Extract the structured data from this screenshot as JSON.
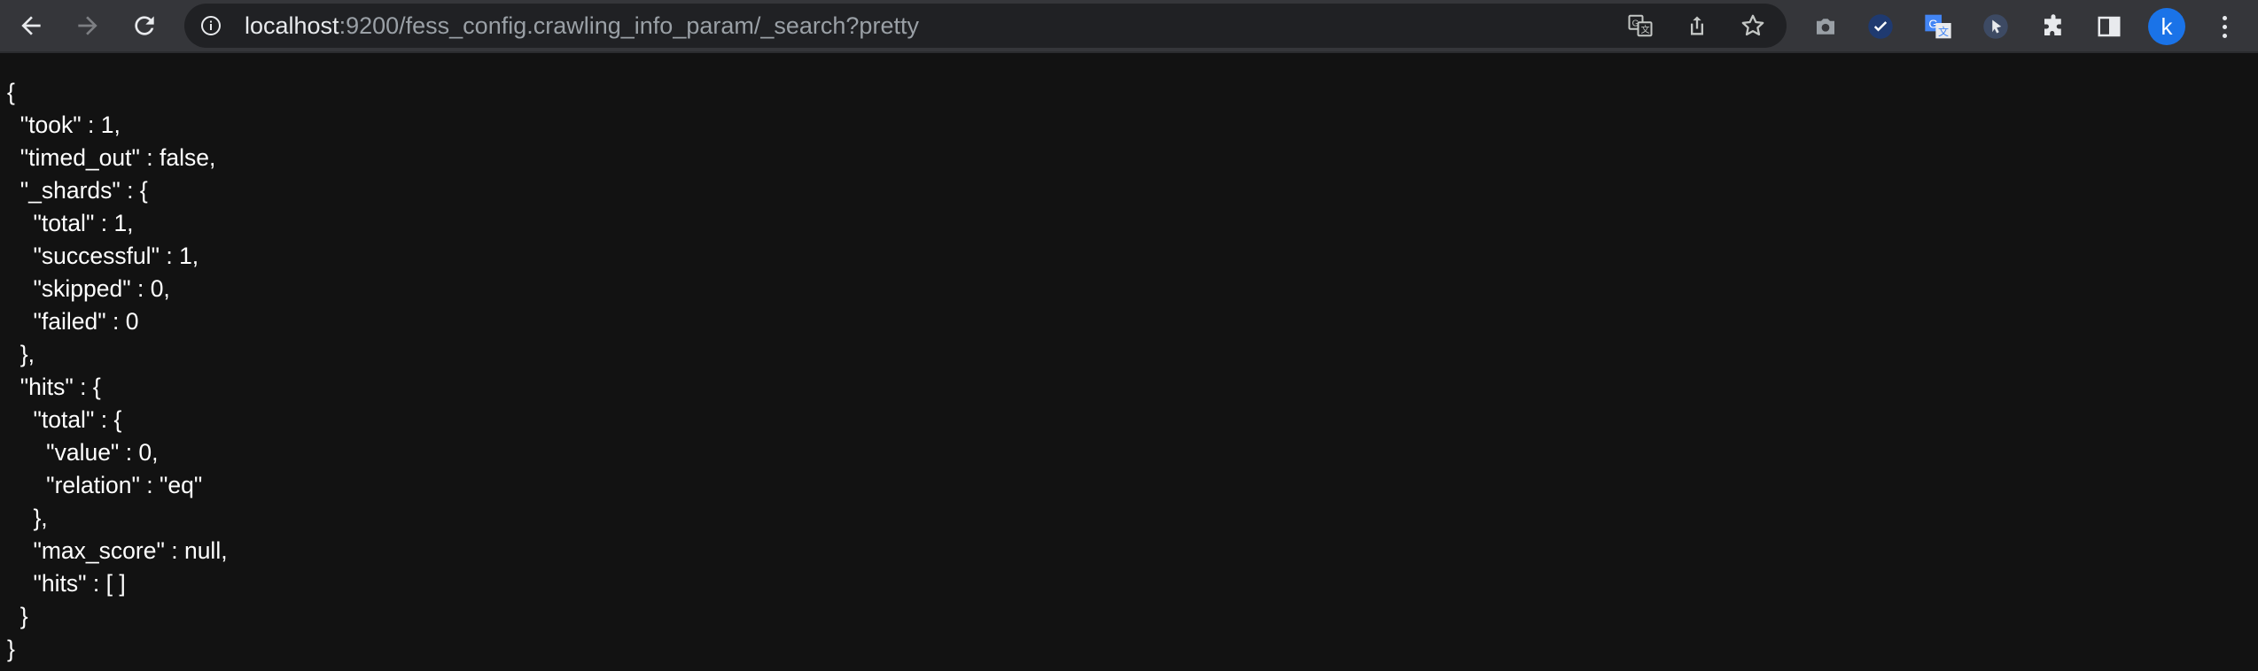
{
  "browser": {
    "url_host": "localhost",
    "url_rest": ":9200/fess_config.crawling_info_param/_search?pretty",
    "avatar_letter": "k",
    "icons": [
      "back-arrow-icon",
      "forward-arrow-icon",
      "reload-icon",
      "info-icon",
      "translate-icon",
      "share-icon",
      "star-icon",
      "camera-icon",
      "check-extension-icon",
      "google-translate-extension-icon",
      "cursor-extension-icon",
      "puzzle-extensions-icon",
      "side-panel-icon",
      "kebab-menu-icon"
    ],
    "accent_color": "#1a73e8"
  },
  "json_lines": [
    "{",
    "  \"took\" : 1,",
    "  \"timed_out\" : false,",
    "  \"_shards\" : {",
    "    \"total\" : 1,",
    "    \"successful\" : 1,",
    "    \"skipped\" : 0,",
    "    \"failed\" : 0",
    "  },",
    "  \"hits\" : {",
    "    \"total\" : {",
    "      \"value\" : 0,",
    "      \"relation\" : \"eq\"",
    "    },",
    "    \"max_score\" : null,",
    "    \"hits\" : [ ]",
    "  }",
    "}"
  ]
}
